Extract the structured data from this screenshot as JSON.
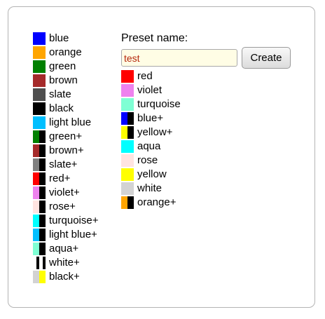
{
  "colors": [
    {
      "label": "blue",
      "swatch": [
        "#0000ff"
      ]
    },
    {
      "label": "orange",
      "swatch": [
        "#ffa500"
      ]
    },
    {
      "label": "green",
      "swatch": [
        "#008000"
      ]
    },
    {
      "label": "brown",
      "swatch": [
        "#a52a2a"
      ]
    },
    {
      "label": "slate",
      "swatch": [
        "#4f4f4f"
      ]
    },
    {
      "label": "black",
      "swatch": [
        "#000000"
      ]
    },
    {
      "label": "light blue",
      "swatch": [
        "#00bfff"
      ]
    },
    {
      "label": "green+",
      "swatch": [
        "#008000",
        "#000000"
      ]
    },
    {
      "label": "brown+",
      "swatch": [
        "#a52a2a",
        "#000000"
      ]
    },
    {
      "label": "slate+",
      "swatch": [
        "#808080",
        "#000000"
      ]
    },
    {
      "label": "red+",
      "swatch": [
        "#ff0000",
        "#000000"
      ]
    },
    {
      "label": "violet+",
      "swatch": [
        "#ee82ee",
        "#000000"
      ]
    },
    {
      "label": "rose+",
      "swatch": [
        "#ffe4e1",
        "#000000"
      ]
    },
    {
      "label": "turquoise+",
      "swatch": [
        "#00ffff",
        "#000000"
      ]
    },
    {
      "label": "light blue+",
      "swatch": [
        "#00bfff",
        "#000000"
      ]
    },
    {
      "label": "aqua+",
      "swatch": [
        "#7fffd4",
        "#000000"
      ]
    },
    {
      "label": "white+",
      "swatch": [
        "#ffffff",
        "#000000",
        "#ffffff",
        "#000000"
      ]
    },
    {
      "label": "black+",
      "swatch": [
        "#d3d3d3",
        "#ffff00"
      ]
    }
  ],
  "preset": {
    "label": "Preset name:",
    "value": "test",
    "create_label": "Create"
  },
  "preset_colors": [
    {
      "label": "red",
      "swatch": [
        "#ff0000"
      ]
    },
    {
      "label": "violet",
      "swatch": [
        "#ee82ee"
      ]
    },
    {
      "label": "turquoise",
      "swatch": [
        "#7fffd4"
      ]
    },
    {
      "label": "blue+",
      "swatch": [
        "#0000ff",
        "#000000"
      ]
    },
    {
      "label": "yellow+",
      "swatch": [
        "#ffff00",
        "#000000"
      ]
    },
    {
      "label": "aqua",
      "swatch": [
        "#00ffff"
      ]
    },
    {
      "label": "rose",
      "swatch": [
        "#ffe4e1"
      ]
    },
    {
      "label": "yellow",
      "swatch": [
        "#ffff00"
      ]
    },
    {
      "label": "white",
      "swatch": [
        "#d3d3d3"
      ]
    },
    {
      "label": "orange+",
      "swatch": [
        "#ffa500",
        "#000000"
      ]
    }
  ]
}
